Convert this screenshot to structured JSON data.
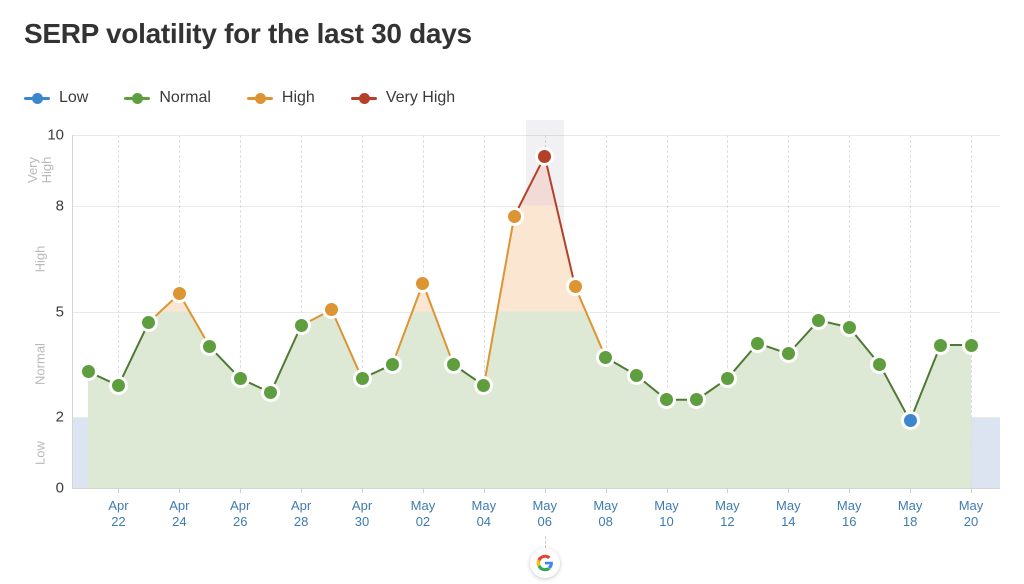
{
  "header": {
    "title": "SERP volatility for the last 30 days"
  },
  "legend": {
    "position": "top-left",
    "items": [
      {
        "label": "Low",
        "color": "#3b87cc",
        "name": "legend-item-low"
      },
      {
        "label": "Normal",
        "color": "#5f9e3f",
        "name": "legend-item-normal"
      },
      {
        "label": "High",
        "color": "#dd9433",
        "name": "legend-item-high"
      },
      {
        "label": "Very High",
        "color": "#b4402a",
        "name": "legend-item-very-high"
      }
    ]
  },
  "axes": {
    "y_ticks": [
      0,
      2,
      5,
      8,
      10
    ],
    "y_zone_labels": [
      "Low",
      "Normal",
      "High",
      "Very High"
    ],
    "x_tick_labels": [
      {
        "month": "Apr",
        "day": "22"
      },
      {
        "month": "Apr",
        "day": "24"
      },
      {
        "month": "Apr",
        "day": "26"
      },
      {
        "month": "Apr",
        "day": "28"
      },
      {
        "month": "Apr",
        "day": "30"
      },
      {
        "month": "May",
        "day": "02"
      },
      {
        "month": "May",
        "day": "04"
      },
      {
        "month": "May",
        "day": "06"
      },
      {
        "month": "May",
        "day": "08"
      },
      {
        "month": "May",
        "day": "10"
      },
      {
        "month": "May",
        "day": "12"
      },
      {
        "month": "May",
        "day": "14"
      },
      {
        "month": "May",
        "day": "16"
      },
      {
        "month": "May",
        "day": "18"
      },
      {
        "month": "May",
        "day": "20"
      }
    ]
  },
  "annotations": {
    "highlight_date": "May 06",
    "badge_icon": "google-g-icon",
    "badge_label": "G"
  },
  "colors": {
    "low": "#3b87cc",
    "normal": "#5f9e3f",
    "high": "#dd9433",
    "very_high": "#b4402a",
    "low_band": "#dde4f1",
    "normal_fill": "#dde8d5",
    "high_fill": "#fbe6d2",
    "very_high_fill": "#f2dad6",
    "highlight_band": "#b3adbd",
    "x_label": "#3e7bb0",
    "grid": "#e9e9e9",
    "title": "#333333"
  },
  "chart_data": {
    "type": "area",
    "title": "SERP volatility for the last 30 days",
    "xlabel": "",
    "ylabel": "",
    "ylim": [
      0,
      10
    ],
    "xlim": [
      "Apr 21",
      "May 20"
    ],
    "grid": true,
    "legend_position": "top-left",
    "zones": [
      {
        "name": "Low",
        "range": [
          0,
          2
        ],
        "color": "#3b87cc"
      },
      {
        "name": "Normal",
        "range": [
          2,
          5
        ],
        "color": "#5f9e3f"
      },
      {
        "name": "High",
        "range": [
          5,
          8
        ],
        "color": "#dd9433"
      },
      {
        "name": "Very High",
        "range": [
          8,
          10
        ],
        "color": "#b4402a"
      }
    ],
    "x": [
      "Apr 21",
      "Apr 22",
      "Apr 23",
      "Apr 24",
      "Apr 25",
      "Apr 26",
      "Apr 27",
      "Apr 28",
      "Apr 29",
      "Apr 30",
      "May 01",
      "May 02",
      "May 03",
      "May 04",
      "May 05",
      "May 06",
      "May 07",
      "May 08",
      "May 09",
      "May 10",
      "May 11",
      "May 12",
      "May 13",
      "May 14",
      "May 15",
      "May 16",
      "May 17",
      "May 18",
      "May 19",
      "May 20"
    ],
    "values": [
      3.3,
      2.9,
      4.7,
      5.5,
      4.0,
      3.1,
      2.7,
      4.6,
      5.05,
      3.1,
      3.5,
      5.8,
      3.5,
      2.9,
      7.7,
      9.4,
      5.7,
      3.7,
      3.2,
      2.5,
      2.5,
      3.1,
      4.1,
      3.8,
      4.75,
      4.55,
      3.5,
      1.9,
      4.05,
      4.05
    ],
    "point_levels": [
      "normal",
      "normal",
      "normal",
      "high",
      "normal",
      "normal",
      "normal",
      "normal",
      "high",
      "normal",
      "normal",
      "high",
      "normal",
      "normal",
      "high",
      "very_high",
      "high",
      "normal",
      "normal",
      "normal",
      "normal",
      "normal",
      "normal",
      "normal",
      "normal",
      "normal",
      "normal",
      "low",
      "normal",
      "normal"
    ]
  }
}
